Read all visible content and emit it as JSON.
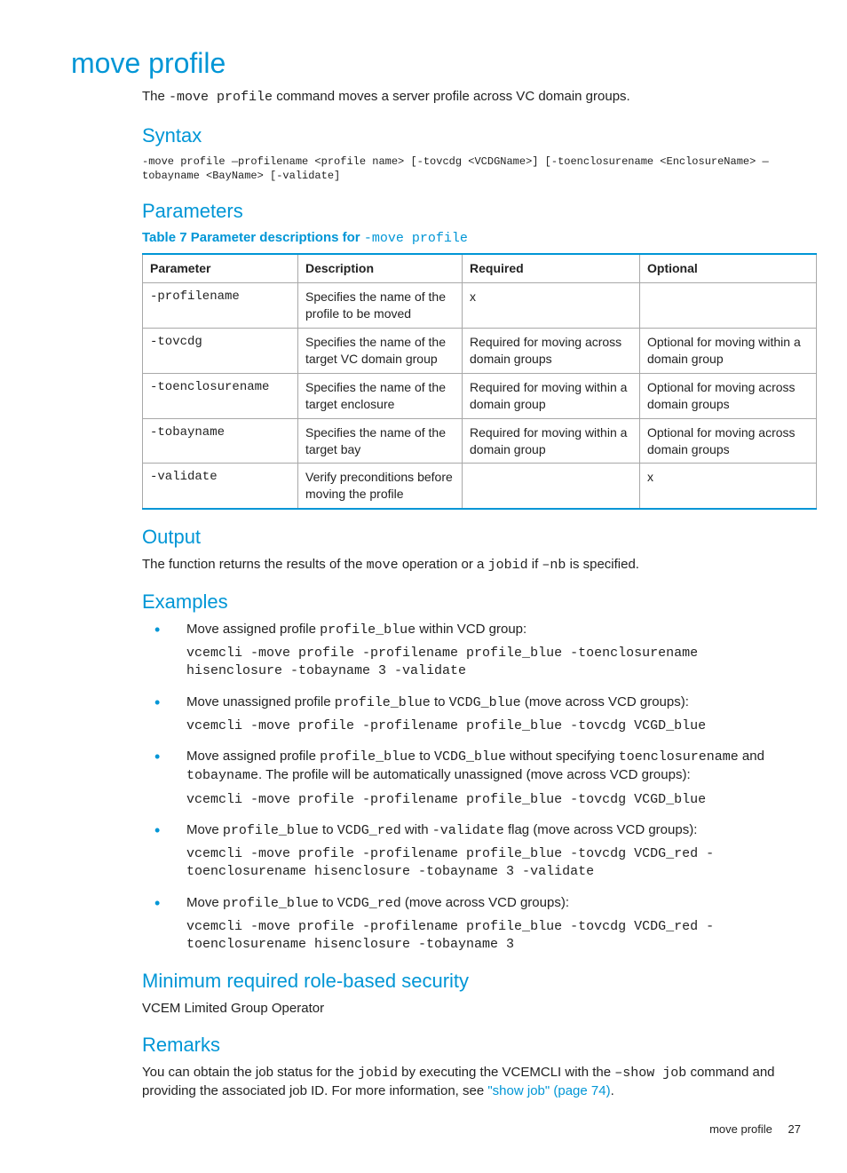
{
  "title": "move profile",
  "intro_pre": "The ",
  "intro_cmd": "-move profile",
  "intro_post": " command moves a server profile across VC domain groups.",
  "syntax": {
    "heading": "Syntax",
    "text": "-move profile —profilename <profile name> [-tovcdg <VCDGName>] [-toenclosurename <EnclosureName> —tobayname <BayName> [-validate]"
  },
  "parameters": {
    "heading": "Parameters",
    "caption_pre": "Table 7 Parameter descriptions for ",
    "caption_cmd": "-move profile",
    "headers": [
      "Parameter",
      "Description",
      "Required",
      "Optional"
    ],
    "rows": [
      {
        "param": "-profilename",
        "desc": "Specifies the name of the profile to be moved",
        "req": "x",
        "opt": ""
      },
      {
        "param": "-tovcdg",
        "desc": "Specifies the name of the target VC domain group",
        "req": "Required for moving across domain groups",
        "opt": "Optional for moving within a domain group"
      },
      {
        "param": "-toenclosurename",
        "desc": "Specifies the name of the target enclosure",
        "req": "Required for moving within a domain group",
        "opt": "Optional for moving across domain groups"
      },
      {
        "param": "-tobayname",
        "desc": "Specifies the name of the target bay",
        "req": "Required for moving within a domain group",
        "opt": "Optional for moving across domain groups"
      },
      {
        "param": "-validate",
        "desc": "Verify preconditions before moving the profile",
        "req": "",
        "opt": "x"
      }
    ]
  },
  "output": {
    "heading": "Output",
    "t1": "The function returns the results of the ",
    "c1": "move",
    "t2": " operation or a ",
    "c2": "jobid",
    "t3": " if ",
    "c3": "–nb",
    "t4": " is specified."
  },
  "examples": {
    "heading": "Examples",
    "items": [
      {
        "desc_parts": [
          {
            "t": "Move assigned profile "
          },
          {
            "c": "profile_blue"
          },
          {
            "t": " within VCD group:"
          }
        ],
        "cmd": "vcemcli -move profile -profilename profile_blue -toenclosurename hisenclosure -tobayname 3 -validate"
      },
      {
        "desc_parts": [
          {
            "t": "Move unassigned profile "
          },
          {
            "c": "profile_blue"
          },
          {
            "t": " to "
          },
          {
            "c": "VCDG_blue"
          },
          {
            "t": " (move across VCD groups):"
          }
        ],
        "cmd": "vcemcli -move profile -profilename profile_blue -tovcdg VCGD_blue"
      },
      {
        "desc_parts": [
          {
            "t": "Move assigned profile "
          },
          {
            "c": "profile_blue"
          },
          {
            "t": " to "
          },
          {
            "c": "VCDG_blue"
          },
          {
            "t": " without specifying "
          },
          {
            "c": "toenclosurename"
          },
          {
            "t": " and "
          },
          {
            "c": "tobayname"
          },
          {
            "t": ". The profile will be automatically unassigned (move across VCD groups):"
          }
        ],
        "cmd": "vcemcli -move profile -profilename profile_blue -tovcdg VCGD_blue"
      },
      {
        "desc_parts": [
          {
            "t": "Move "
          },
          {
            "c": "profile_blue"
          },
          {
            "t": " to "
          },
          {
            "c": "VCDG_red"
          },
          {
            "t": " with "
          },
          {
            "c": "-validate"
          },
          {
            "t": " flag (move across VCD groups):"
          }
        ],
        "cmd": "vcemcli -move profile -profilename profile_blue -tovcdg VCDG_red -toenclosurename hisenclosure -tobayname 3 -validate"
      },
      {
        "desc_parts": [
          {
            "t": "Move "
          },
          {
            "c": "profile_blue"
          },
          {
            "t": " to "
          },
          {
            "c": "VCDG_red"
          },
          {
            "t": " (move across VCD groups):"
          }
        ],
        "cmd": "vcemcli -move profile -profilename profile_blue -tovcdg VCDG_red -toenclosurename hisenclosure -tobayname 3"
      }
    ]
  },
  "min_role": {
    "heading": "Minimum required role-based security",
    "text": "VCEM Limited Group Operator"
  },
  "remarks": {
    "heading": "Remarks",
    "t1": "You can obtain the job status for the ",
    "c1": "jobid",
    "t2": " by executing the VCEMCLI with the ",
    "c2": "–show job",
    "t3": " command and providing the associated job ID. For more information, see ",
    "link": "\"show job\" (page 74)",
    "t4": "."
  },
  "footer": {
    "label": "move profile",
    "page": "27"
  }
}
